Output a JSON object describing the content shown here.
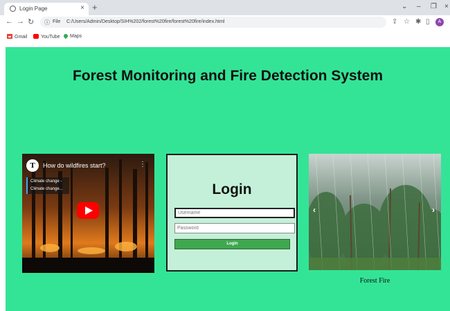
{
  "browser": {
    "tab_title": "Login Page",
    "tab_close": "×",
    "new_tab": "+",
    "url_scheme": "File",
    "url": "C:/Users/Admin/Desktop/SIH%202/forest%20fire/forest%20fire/index.html",
    "avatar_letter": "A",
    "bookmarks": [
      {
        "label": "Gmail",
        "icon": "gmail-icon",
        "color": "#ea4335"
      },
      {
        "label": "YouTube",
        "icon": "youtube-icon",
        "color": "#ff0000"
      },
      {
        "label": "Maps",
        "icon": "maps-icon",
        "color": "#34a853"
      }
    ]
  },
  "page": {
    "title": "Forest Monitoring and Fire Detection System",
    "background": "#33e497"
  },
  "video": {
    "channel_logo": "T",
    "title": "How do wildfires start?",
    "chapter_line1": "Climate change -",
    "chapter_line2": "Climate change..."
  },
  "login": {
    "title": "Login",
    "username_placeholder": "Username",
    "password_placeholder": "Password",
    "button_label": "Login",
    "button_color": "#3fa84f"
  },
  "carousel": {
    "prev": "‹",
    "next": "›",
    "caption": "Forest Fire"
  }
}
